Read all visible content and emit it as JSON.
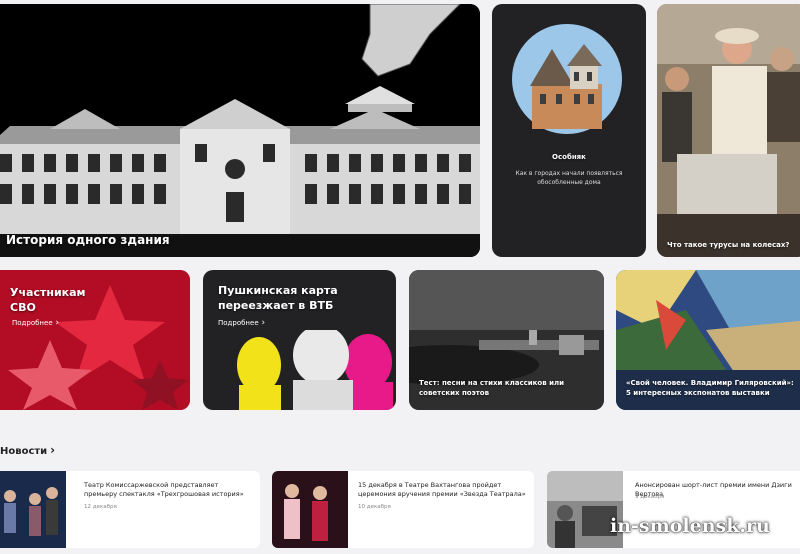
{
  "tiles": {
    "building": {
      "title": "История одного здания"
    },
    "mansion": {
      "title": "Особняк",
      "subtitle": "Как в городах начали появляться обособленные дома"
    },
    "turusy": {
      "title": "Что такое турусы на колесах?"
    },
    "svo": {
      "title": "Участникам СВО",
      "more": "Подробнее"
    },
    "pushkin": {
      "title": "Пушкинская карта переезжает в ВТБ",
      "more": "Подробнее"
    },
    "songs": {
      "title": "Тест: песни на стихи классиков или советских поэтов"
    },
    "exhibit": {
      "title": "«Свой человек. Владимир Гиляровский»: 5 интересных экспонатов выставки"
    }
  },
  "news": {
    "heading": "Новости",
    "items": [
      {
        "title": "Театр Комиссаржевской представляет премьеру спектакля «Трехгрошовая история»",
        "date": "12 декабря"
      },
      {
        "title": "15 декабря в Театре Вахтангова пройдет церемония вручения премии «Звезда Театрала»",
        "date": "10 декабря"
      },
      {
        "title": "Анонсирован шорт-лист премии имени Дзиги Вертова",
        "date": "9 декабря"
      }
    ]
  },
  "watermark": "in-smolensk.ru",
  "colors": {
    "background": "#f2f2f4",
    "dark_tile": "#222225",
    "red": "#c8102e"
  }
}
